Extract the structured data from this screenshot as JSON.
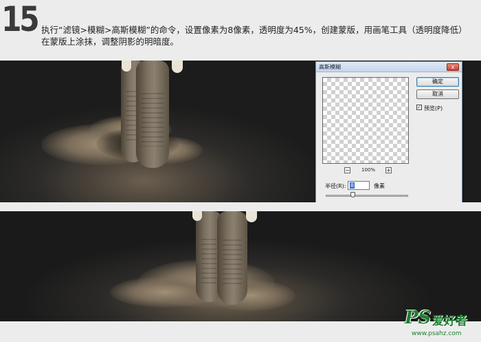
{
  "step": {
    "number": "15",
    "instruction": "执行“滤镜>模糊>高斯模糊”的命令，设置像素为8像素，透明度为45%，创建蒙版，用画笔工具（透明度降低）在蒙版上涂抹，调整阴影的明暗度。"
  },
  "dialog": {
    "title": "高斯模糊",
    "close_glyph": "x",
    "ok_label": "确定",
    "cancel_label": "取消",
    "preview_label": "预览(P)",
    "preview_checked": true,
    "preview_check_glyph": "✓",
    "zoom": "100%",
    "zoom_out_glyph": "−",
    "zoom_in_glyph": "+",
    "radius_label": "半径(R):",
    "radius_value": "8",
    "radius_unit": "像素"
  },
  "watermark": {
    "logo": "PS",
    "text": "爱好者",
    "url": "www.psahz.com"
  },
  "colors": {
    "watermark_green": "#1d7f2e",
    "header_bg": "#ececec",
    "step_number": "#3a3a3a"
  }
}
